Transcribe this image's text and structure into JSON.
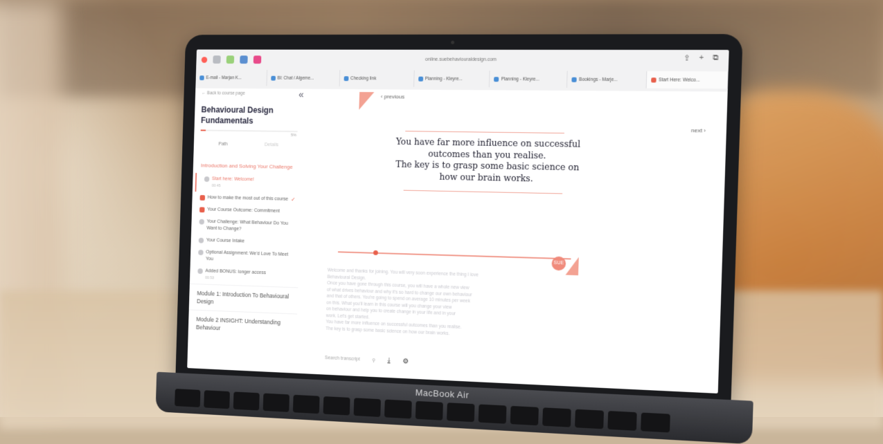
{
  "browser": {
    "url": "online.suebehaviouraldesign.com",
    "tabs": [
      {
        "label": "E-mail - Marjan K..."
      },
      {
        "label": "Bl: Chat / Algeme..."
      },
      {
        "label": "Checking link"
      },
      {
        "label": "Planning - Kleyre..."
      },
      {
        "label": "Planning - Kleyre..."
      },
      {
        "label": "Bookings - Marje..."
      },
      {
        "label": "Start Here: Welco..."
      }
    ]
  },
  "sidebar": {
    "back_label": "← Back to course page",
    "course_title": "Behavioural Design Fundamentals",
    "progress_fraction": 0.05,
    "progress_text": "5%",
    "tabs": {
      "path": "Path",
      "details": "Details"
    },
    "active_section": "Introduction and Solving Your Challenge",
    "items": [
      {
        "label": "Start here: Welcome!",
        "sub": "00:45"
      },
      {
        "label": "How to make the most out of this course"
      },
      {
        "label": "Your Course Outcome: Commitment"
      },
      {
        "label": "Your Challenge: What Behaviour Do You Want to Change?"
      },
      {
        "label": "Your Course Intake"
      },
      {
        "label": "Optional Assignment: We'd Love To Meet You"
      },
      {
        "label": "Added BONUS: longer access",
        "sub": "00:53"
      }
    ],
    "modules": [
      {
        "label": "Module 1: Introduction To Behavioural Design"
      },
      {
        "label": "Module 2 INSIGHT: Understanding Behaviour"
      }
    ]
  },
  "main": {
    "previous_label": "‹ previous",
    "next_label": "next ›",
    "quote": "You have far more influence on successful\noutcomes than you realise.\nThe key is to grasp some basic science on\nhow our brain works.",
    "badge": "SUE",
    "transcript": [
      "Welcome and thanks for joining. You will very soon experience the thing I love",
      "Behavioural Design.",
      "Once you have gone through this course, you will have a whole new view",
      "of what drives behaviour and why it's so hard to change our own behaviour",
      "and that of others. You're going to spend on average 10 minutes per week",
      "on this. What you'll learn in this course will you change your view",
      "on behaviour and help you to create change in your life and in your",
      "work. Let's get started.",
      "You have far more influence on successful outcomes than you realise.",
      "The key is to grasp some basic science on how our brain works."
    ],
    "search_placeholder": "Search transcript"
  },
  "device": {
    "brand": "MacBook Air"
  }
}
